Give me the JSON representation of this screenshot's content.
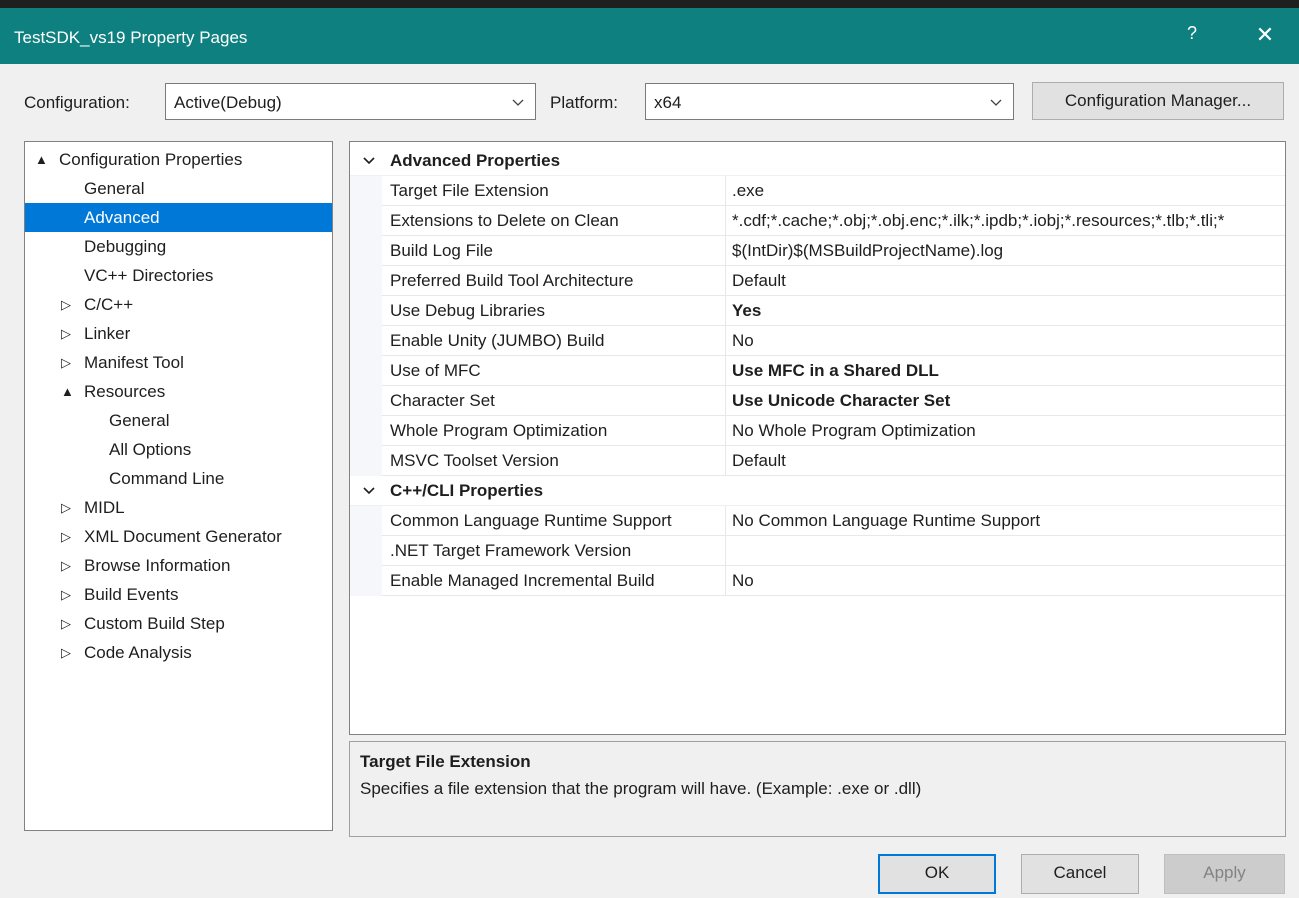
{
  "window": {
    "title": "TestSDK_vs19 Property Pages",
    "help_label": "?",
    "close_label": "✕"
  },
  "toolbar": {
    "configuration_label": "Configuration:",
    "configuration_value": "Active(Debug)",
    "platform_label": "Platform:",
    "platform_value": "x64",
    "config_manager_label": "Configuration Manager..."
  },
  "tree": {
    "items": [
      {
        "label": "Configuration Properties",
        "expander": "▲"
      },
      {
        "label": "General"
      },
      {
        "label": "Advanced"
      },
      {
        "label": "Debugging"
      },
      {
        "label": "VC++ Directories"
      },
      {
        "label": "C/C++",
        "expander": "▷"
      },
      {
        "label": "Linker",
        "expander": "▷"
      },
      {
        "label": "Manifest Tool",
        "expander": "▷"
      },
      {
        "label": "Resources",
        "expander": "▲"
      },
      {
        "label": "General"
      },
      {
        "label": "All Options"
      },
      {
        "label": "Command Line"
      },
      {
        "label": "MIDL",
        "expander": "▷"
      },
      {
        "label": "XML Document Generator",
        "expander": "▷"
      },
      {
        "label": "Browse Information",
        "expander": "▷"
      },
      {
        "label": "Build Events",
        "expander": "▷"
      },
      {
        "label": "Custom Build Step",
        "expander": "▷"
      },
      {
        "label": "Code Analysis",
        "expander": "▷"
      }
    ],
    "selected": "Advanced"
  },
  "grid": {
    "categories": [
      {
        "title": "Advanced Properties",
        "rows": [
          {
            "name": "Target File Extension",
            "value": ".exe"
          },
          {
            "name": "Extensions to Delete on Clean",
            "value": "*.cdf;*.cache;*.obj;*.obj.enc;*.ilk;*.ipdb;*.iobj;*.resources;*.tlb;*.tli;*"
          },
          {
            "name": "Build Log File",
            "value": "$(IntDir)$(MSBuildProjectName).log"
          },
          {
            "name": "Preferred Build Tool Architecture",
            "value": "Default"
          },
          {
            "name": "Use Debug Libraries",
            "value": "Yes"
          },
          {
            "name": "Enable Unity (JUMBO) Build",
            "value": "No"
          },
          {
            "name": "Use of MFC",
            "value": "Use MFC in a Shared DLL"
          },
          {
            "name": "Character Set",
            "value": "Use Unicode Character Set"
          },
          {
            "name": "Whole Program Optimization",
            "value": "No Whole Program Optimization"
          },
          {
            "name": "MSVC Toolset Version",
            "value": "Default"
          }
        ]
      },
      {
        "title": "C++/CLI Properties",
        "rows": [
          {
            "name": "Common Language Runtime Support",
            "value": "No Common Language Runtime Support"
          },
          {
            "name": ".NET Target Framework Version",
            "value": ""
          },
          {
            "name": "Enable Managed Incremental Build",
            "value": "No"
          }
        ]
      }
    ]
  },
  "description": {
    "title": "Target File Extension",
    "text": "Specifies a file extension that the program will have. (Example: .exe or .dll)"
  },
  "buttons": {
    "ok": "OK",
    "cancel": "Cancel",
    "apply": "Apply"
  },
  "colors": {
    "titlebar": "#0e8080",
    "selection": "#0078d7"
  }
}
